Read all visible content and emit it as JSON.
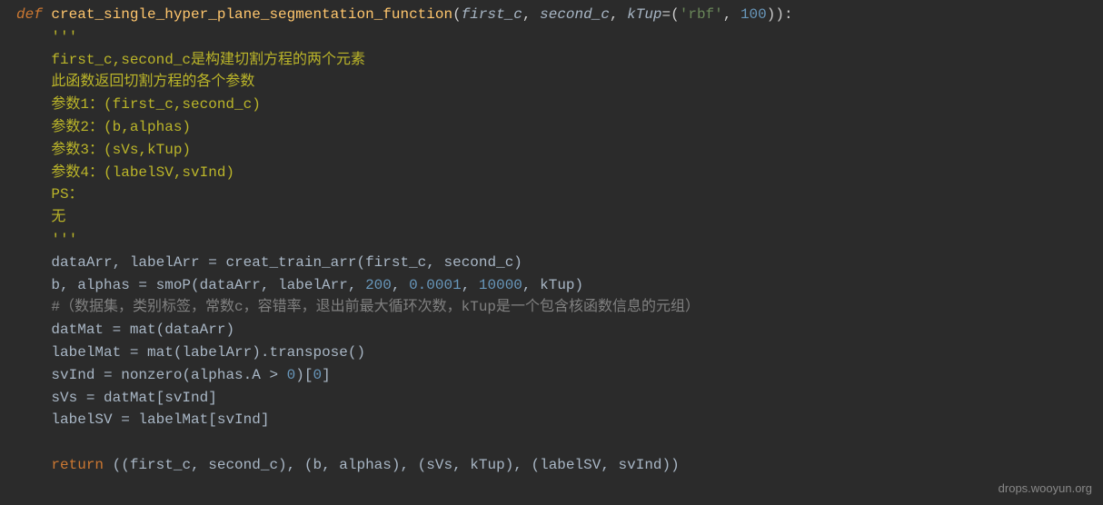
{
  "code": {
    "l1_def": "def ",
    "l1_fn": "creat_single_hyper_plane_segmentation_function",
    "l1_paren_open": "(",
    "l1_p1": "first_c",
    "l1_c1": ", ",
    "l1_p2": "second_c",
    "l1_c2": ", ",
    "l1_p3": "kTup",
    "l1_eq": "=(",
    "l1_str": "'rbf'",
    "l1_c3": ", ",
    "l1_n1": "100",
    "l1_close": ")):",
    "l2": "    '''",
    "l3": "    first_c,second_c是构建切割方程的两个元素",
    "l4": "    此函数返回切割方程的各个参数",
    "l5": "    参数1：(first_c,second_c)",
    "l6": "    参数2：(b,alphas)",
    "l7": "    参数3：(sVs,kTup)",
    "l8": "    参数4：(labelSV,svInd)",
    "l9": "    PS：",
    "l10": "    无",
    "l11": "    '''",
    "l12_a": "    dataArr, labelArr ",
    "l12_op": "= ",
    "l12_fn": "creat_train_arr",
    "l12_b": "(first_c, second_c)",
    "l13_a": "    b, alphas ",
    "l13_op": "= ",
    "l13_fn": "smoP",
    "l13_b": "(dataArr, labelArr, ",
    "l13_n1": "200",
    "l13_c1": ", ",
    "l13_n2": "0.0001",
    "l13_c2": ", ",
    "l13_n3": "10000",
    "l13_c3": ", kTup)",
    "l14": "    #（数据集，类别标签，常数c，容错率，退出前最大循环次数，kTup是一个包含核函数信息的元组）",
    "l15_a": "    datMat ",
    "l15_op": "= ",
    "l15_fn": "mat",
    "l15_b": "(dataArr)",
    "l16_a": "    labelMat ",
    "l16_op": "= ",
    "l16_fn": "mat",
    "l16_b": "(labelArr).transpose()",
    "l17_a": "    svInd ",
    "l17_op": "= ",
    "l17_fn": "nonzero",
    "l17_b": "(alphas.A ",
    "l17_gt": "> ",
    "l17_n": "0",
    "l17_c": ")[",
    "l17_n2": "0",
    "l17_d": "]",
    "l18_a": "    sVs ",
    "l18_op": "= ",
    "l18_b": "datMat[svInd]",
    "l19_a": "    labelSV ",
    "l19_op": "= ",
    "l19_b": "labelMat[svInd]",
    "l20": "",
    "l21_ret": "    return ",
    "l21_b": "((first_c, second_c), (b, alphas), (sVs, kTup), (labelSV, svInd))"
  },
  "watermark": "drops.wooyun.org"
}
